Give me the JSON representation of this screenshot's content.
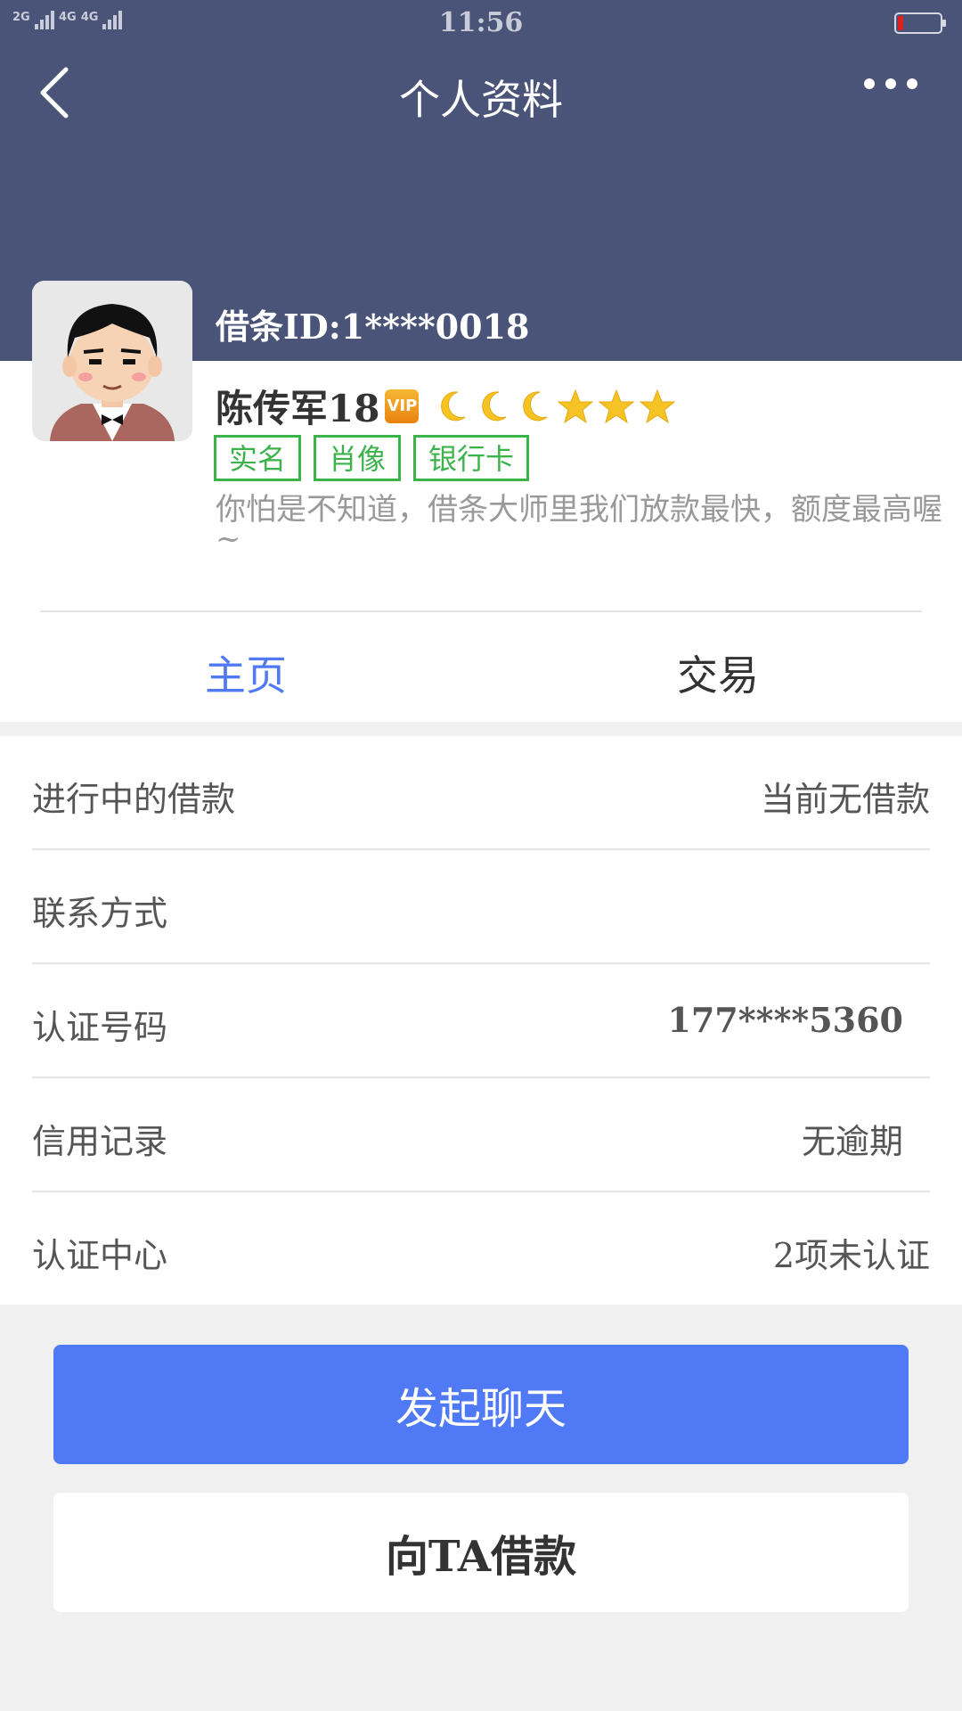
{
  "status_bar": {
    "signal1_label": "2G",
    "signal2_label": "4G",
    "signal3_label": "4G",
    "time": "11:56"
  },
  "header": {
    "title": "个人资料",
    "back_icon": "chevron-left-icon",
    "more_icon": "more-dots-icon"
  },
  "profile": {
    "id_text": "借条ID:1****0018",
    "name": "陈传军18",
    "vip_badge": "VIP",
    "rating_icons": [
      "moon",
      "moon",
      "moon",
      "star",
      "star",
      "star"
    ],
    "tags": [
      "实名",
      "肖像",
      "银行卡"
    ],
    "bio": "你怕是不知道，借条大师里我们放款最快，额度最高喔~"
  },
  "tabs": [
    {
      "label": "主页",
      "active": true
    },
    {
      "label": "交易",
      "active": false
    }
  ],
  "info_rows": [
    {
      "label": "进行中的借款",
      "value": "当前无借款"
    },
    {
      "label": "联系方式",
      "value": ""
    },
    {
      "label": "认证号码",
      "value": "177****5360"
    },
    {
      "label": "信用记录",
      "value": "无逾期"
    },
    {
      "label": "认证中心",
      "value": "2项未认证"
    }
  ],
  "buttons": {
    "chat": "发起聊天",
    "lend": "向TA借款"
  },
  "colors": {
    "header_bg": "#4a5378",
    "accent_blue": "#4f79f5",
    "tag_green": "#3cb34a",
    "page_bg": "#f0f0f0"
  }
}
